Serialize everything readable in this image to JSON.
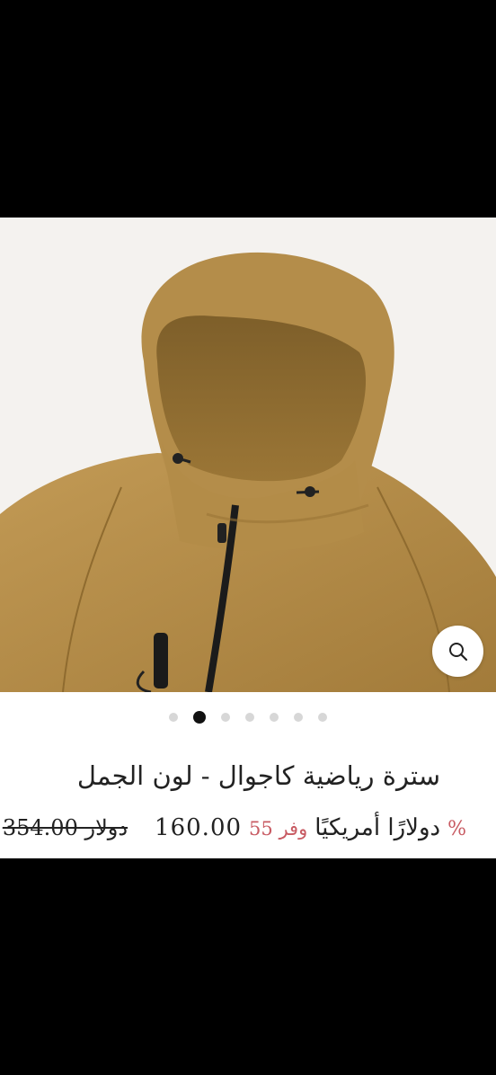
{
  "gallery": {
    "image_description_icon": "jacket-photo",
    "zoom_icon": "search-icon",
    "dots_count": 7,
    "active_dot_index": 1
  },
  "product": {
    "title": "سترة رياضية كاجوال - لون الجمل",
    "percent_symbol": "%",
    "currency_text": "دولارًا أمريكيًا",
    "save_text": "وفر 55",
    "price": "160.00",
    "old_price_value": "354.00",
    "old_price_currency": "دولار"
  },
  "colors": {
    "accent_red": "#c85b63",
    "jacket_camel": "#b08a47"
  }
}
